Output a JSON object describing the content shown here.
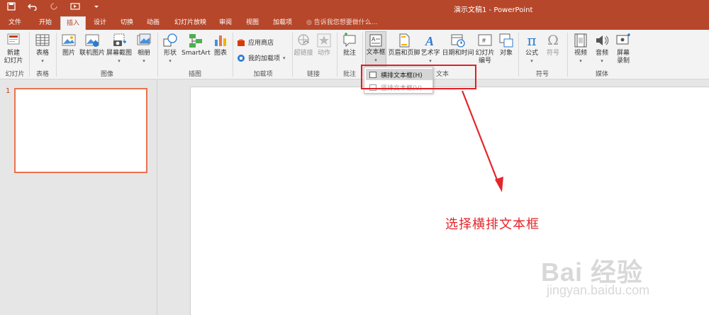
{
  "window": {
    "doc_title": "演示文稿1 - PowerPoint",
    "qat": {
      "save_icon": "save-icon",
      "undo_icon": "undo-icon",
      "redo_icon": "redo-icon",
      "present_icon": "start-from-beginning-icon"
    }
  },
  "tabs": [
    {
      "label": "文件"
    },
    {
      "label": "开始"
    },
    {
      "label": "插入"
    },
    {
      "label": "设计"
    },
    {
      "label": "切换"
    },
    {
      "label": "动画"
    },
    {
      "label": "幻灯片放映"
    },
    {
      "label": "审阅"
    },
    {
      "label": "视图"
    },
    {
      "label": "加载项"
    }
  ],
  "active_tab": "插入",
  "tell_me": "告诉我您想要做什么...",
  "ribbon": {
    "new_slide": "新建\n幻灯片",
    "table": "表格",
    "picture": "图片",
    "online_picture": "联机图片",
    "screenshot": "屏幕截图",
    "album": "相册",
    "shapes": "形状",
    "smartart": "SmartArt",
    "chart": "图表",
    "store": "应用商店",
    "my_addins": "我的加载项",
    "hyperlink": "超链接",
    "action": "动作",
    "comment": "批注",
    "textbox": "文本框",
    "header_footer": "页眉和页脚",
    "wordart": "艺术字",
    "datetime": "日期和时间",
    "slide_number": "幻灯片\n编号",
    "object": "对象",
    "equation": "公式",
    "symbol": "符号",
    "video": "视频",
    "audio": "音频",
    "screen_record": "屏幕\n录制",
    "groups": {
      "slides": "幻灯片",
      "tables": "表格",
      "images": "图像",
      "illustrations": "插图",
      "addins": "加载项",
      "links": "链接",
      "comments": "批注",
      "text": "文本",
      "symbols": "符号",
      "media": "媒体"
    }
  },
  "textbox_menu": {
    "horizontal": "横排文本框(H)",
    "vertical": "竖排文本框(V)"
  },
  "slide_panel": {
    "slide_number": "1"
  },
  "annotation": "选择横排文本框",
  "watermark": {
    "logo": "Bai 经验",
    "url": "jingyan.baidu.com"
  },
  "colors": {
    "accent": "#b7472a",
    "annotation": "#e3262b"
  }
}
